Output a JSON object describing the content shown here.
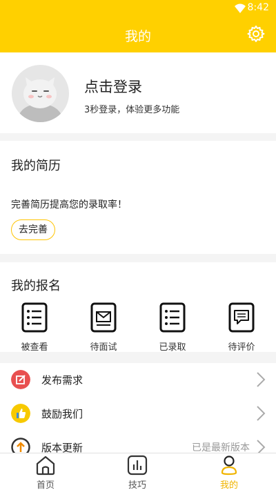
{
  "status_bar": {
    "time": "8:42"
  },
  "header": {
    "title": "我的",
    "settings_icon": "gear-icon"
  },
  "profile": {
    "login_title": "点击登录",
    "login_subtitle": "3秒登录，体验更多功能"
  },
  "resume": {
    "title": "我的简历",
    "description": "完善简历提高您的录取率！",
    "button_label": "去完善"
  },
  "applications": {
    "title": "我的报名",
    "items": [
      {
        "label": "被查看",
        "icon": "list-document-icon"
      },
      {
        "label": "待面试",
        "icon": "envelope-document-icon"
      },
      {
        "label": "已录取",
        "icon": "list-document-icon"
      },
      {
        "label": "待评价",
        "icon": "comment-document-icon"
      }
    ]
  },
  "menu": [
    {
      "label": "发布需求",
      "icon": "edit-icon",
      "color": "#e85050"
    },
    {
      "label": "鼓励我们",
      "icon": "thumbs-up-icon",
      "color": "#f7c900"
    },
    {
      "label": "版本更新",
      "icon": "upload-arrow-icon",
      "color": "#f08a00",
      "value": "已是最新版本"
    }
  ],
  "tab_bar": {
    "items": [
      {
        "label": "首页",
        "icon": "home-icon"
      },
      {
        "label": "技巧",
        "icon": "chart-icon"
      },
      {
        "label": "我的",
        "icon": "person-icon",
        "active": true
      }
    ]
  },
  "colors": {
    "brand": "#ffd000",
    "active_tab": "#f0b400"
  }
}
